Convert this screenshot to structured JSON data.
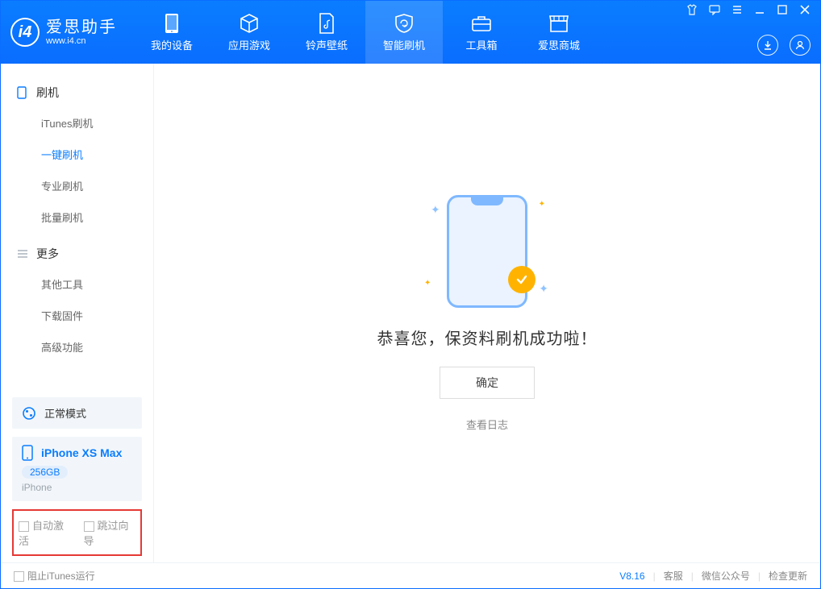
{
  "app": {
    "title": "爱思助手",
    "subtitle": "www.i4.cn"
  },
  "nav": {
    "items": [
      {
        "label": "我的设备"
      },
      {
        "label": "应用游戏"
      },
      {
        "label": "铃声壁纸"
      },
      {
        "label": "智能刷机"
      },
      {
        "label": "工具箱"
      },
      {
        "label": "爱思商城"
      }
    ]
  },
  "sidebar": {
    "group1": {
      "title": "刷机",
      "items": [
        "iTunes刷机",
        "一键刷机",
        "专业刷机",
        "批量刷机"
      ]
    },
    "group2": {
      "title": "更多",
      "items": [
        "其他工具",
        "下载固件",
        "高级功能"
      ]
    }
  },
  "device": {
    "mode": "正常模式",
    "name": "iPhone XS Max",
    "capacity": "256GB",
    "type": "iPhone"
  },
  "options": {
    "auto_activate": "自动激活",
    "skip_wizard": "跳过向导"
  },
  "main": {
    "message": "恭喜您，保资料刷机成功啦！",
    "ok_label": "确定",
    "log_link": "查看日志"
  },
  "footer": {
    "block_itunes": "阻止iTunes运行",
    "version": "V8.16",
    "links": [
      "客服",
      "微信公众号",
      "检查更新"
    ]
  }
}
